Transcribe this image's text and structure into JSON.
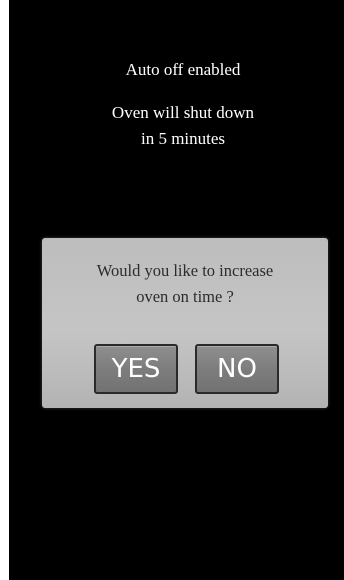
{
  "status": {
    "title": "Auto off enabled",
    "message_line1": "Oven will shut down",
    "message_line2": "in 5 minutes"
  },
  "dialog": {
    "question_line1": "Would you like to increase",
    "question_line2": "oven on time ?",
    "yes_label": "YES",
    "no_label": "NO"
  },
  "colors": {
    "background": "#000000",
    "dialog": "#c0c0c0",
    "button": "#7f7f7f",
    "text_light": "#ffffff",
    "text_dark": "#2c2c2c"
  }
}
